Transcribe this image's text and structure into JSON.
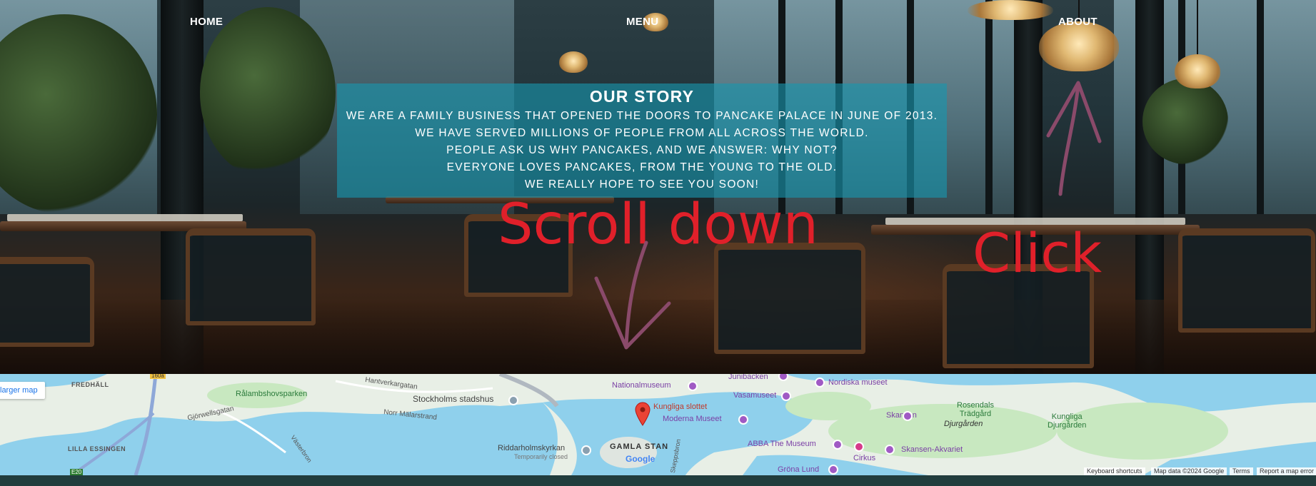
{
  "nav": {
    "home": "HOME",
    "menu": "MENU",
    "about": "ABOUT"
  },
  "story": {
    "title": "OUR STORY",
    "lines": [
      "WE ARE A FAMILY BUSINESS THAT OPENED THE DOORS TO PANCAKE PALACE IN JUNE OF 2013.",
      "WE HAVE SERVED MILLIONS OF PEOPLE FROM ALL ACROSS THE WORLD.",
      "PEOPLE ASK US WHY PANCAKES, AND WE ANSWER: WHY NOT?",
      "EVERYONE LOVES PANCAKES, FROM THE YOUNG TO THE OLD.",
      "WE REALLY HOPE TO SEE YOU SOON!"
    ]
  },
  "annotations": {
    "scroll_down": "Scroll down",
    "click": "Click",
    "color": "#e0202a",
    "arrow_color": "#8a4a6a"
  },
  "map": {
    "larger_map_link": "larger map",
    "labels": {
      "fredhall": "FREDHÄLL",
      "hantverkargatan": "Hantverkargatan",
      "ralambshovsparken": "Rålambshovsparken",
      "stadshus": "Stockholms stadshus",
      "norr_malarstrand": "Norr Mälarstrand",
      "gjorwellsgatan": "Gjörwellsgatan",
      "lilla_essingen": "LILLA ESSINGEN",
      "vastbron": "Västerbron",
      "riddarholmskyrkan": "Riddarholmskyrkan",
      "temporarily_closed": "Temporarily closed",
      "gamla_stan": "GAMLA STAN",
      "nationalmuseum": "Nationalmuseum",
      "kungliga_slottet": "Kungliga slottet",
      "moderna_museet": "Moderna Museet",
      "vasamuseet": "Vasamuseet",
      "junibacken": "Junibacken",
      "nordiska_museet": "Nordiska museet",
      "skansen": "Skansen",
      "abba_museum": "ABBA The Museum",
      "cirkus": "Cirkus",
      "skansen_akvariet": "Skansen-Akvariet",
      "grona_lund": "Gröna Lund",
      "rosendals": "Rosendals\nTrädgård",
      "djurgarden": "Djurgården",
      "kungliga_djurgarden": "Kungliga\nDjurgården",
      "road_160a": "160a",
      "road_e20": "E20",
      "skeppsbron": "Skeppsbron",
      "google": "Google"
    },
    "attribution": {
      "shortcuts": "Keyboard shortcuts",
      "data": "Map data ©2024 Google",
      "terms": "Terms",
      "report": "Report a map error"
    },
    "colors": {
      "water": "#8fd0ec",
      "land": "#e8efe6",
      "park": "#c8e8c0",
      "poi": "#a05ac4",
      "pin": "#ea4335"
    }
  }
}
